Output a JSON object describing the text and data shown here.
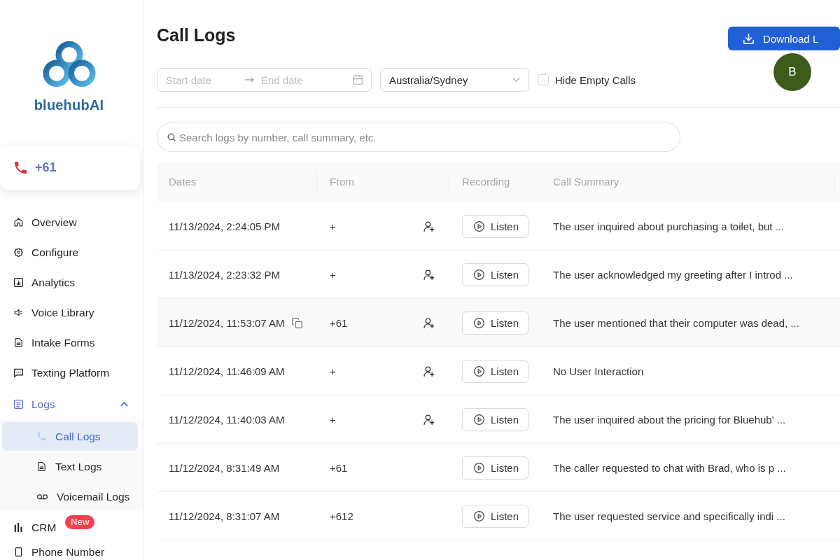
{
  "sidebar": {
    "logo_text": "bluehub**AI**",
    "phone_card": {
      "number": "+61"
    },
    "nav": [
      {
        "label": "Overview",
        "selected": false
      },
      {
        "label": "Configure",
        "selected": false
      },
      {
        "label": "Analytics",
        "selected": false
      },
      {
        "label": "Voice Library",
        "selected": false
      },
      {
        "label": "Intake Forms",
        "selected": false
      },
      {
        "label": "Texting Platform",
        "selected": false
      },
      {
        "label": "Logs",
        "selected": true,
        "expanded": true,
        "children": [
          {
            "label": "Call Logs",
            "selected": true
          },
          {
            "label": "Text Logs",
            "selected": false
          },
          {
            "label": "Voicemail Logs",
            "selected": false
          }
        ]
      },
      {
        "label": "CRM",
        "selected": false,
        "badge": "New"
      },
      {
        "label": "Phone Number",
        "selected": false
      }
    ]
  },
  "header": {
    "title": "Call Logs",
    "download_button": "Download L",
    "avatar": "B"
  },
  "filters": {
    "start_date_placeholder": "Start date",
    "end_date_placeholder": "End date",
    "timezone": "Australia/Sydney",
    "hide_empty_calls": {
      "label": "Hide Empty Calls",
      "checked": false
    }
  },
  "search": {
    "placeholder": "Search logs by number, call summary, etc."
  },
  "table": {
    "columns": [
      "Dates",
      "From",
      "Recording",
      "Call Summary"
    ],
    "rows": [
      {
        "date": "11/13/2024, 2:24:05 PM",
        "from": "+",
        "add_contact": true,
        "recording": "Listen",
        "summary": "The user inquired about purchasing a toilet, but ...",
        "hovered": false
      },
      {
        "date": "11/13/2024, 2:23:32 PM",
        "from": "+",
        "add_contact": true,
        "recording": "Listen",
        "summary": "The user acknowledged my greeting after I introd ...",
        "hovered": false
      },
      {
        "date": "11/12/2024, 11:53:07 AM",
        "from": "+61",
        "add_contact": true,
        "recording": "Listen",
        "summary": "The user mentioned that their computer was dead, ...",
        "hovered": true
      },
      {
        "date": "11/12/2024, 11:46:09 AM",
        "from": "+",
        "add_contact": true,
        "recording": "Listen",
        "summary": "No User Interaction",
        "hovered": false
      },
      {
        "date": "11/12/2024, 11:40:03 AM",
        "from": "+",
        "add_contact": true,
        "recording": "Listen",
        "summary": "The user inquired about the pricing for Bluehub' ...",
        "hovered": false
      },
      {
        "date": "11/12/2024, 8:31:49 AM",
        "from": "+61",
        "add_contact": false,
        "recording": "Listen",
        "summary": "The caller requested to chat with Brad, who is p ...",
        "hovered": false
      },
      {
        "date": "11/12/2024, 8:31:07 AM",
        "from": "+612",
        "add_contact": false,
        "recording": "Listen",
        "summary": "The user requested service and specifically indi ...",
        "hovered": false
      }
    ]
  }
}
